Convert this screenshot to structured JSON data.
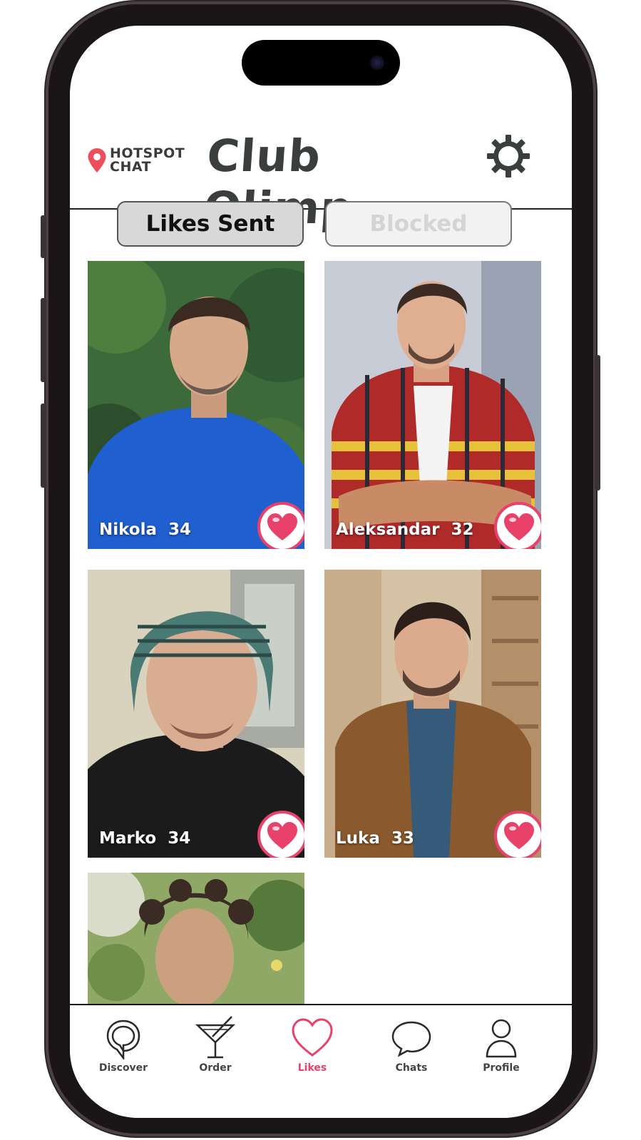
{
  "header": {
    "brand_line1": "HOTSPOT",
    "brand_line2": "CHAT",
    "title": "Club Olimp"
  },
  "tabs": [
    {
      "label": "Likes Sent",
      "active": true
    },
    {
      "label": "Blocked",
      "active": false
    }
  ],
  "profiles": [
    {
      "name": "Nikola",
      "age": "34",
      "display": "Nikola  34"
    },
    {
      "name": "Aleksandar",
      "age": "32",
      "display": "Aleksandar  32"
    },
    {
      "name": "Marko",
      "age": "34",
      "display": "Marko  34"
    },
    {
      "name": "Luka",
      "age": "33",
      "display": "Luka  33"
    },
    {
      "name": "",
      "age": "",
      "display": ""
    }
  ],
  "nav": [
    {
      "label": "Discover",
      "icon": "discover-icon",
      "active": false
    },
    {
      "label": "Order",
      "icon": "cocktail-icon",
      "active": false
    },
    {
      "label": "Likes",
      "icon": "heart-icon",
      "active": true
    },
    {
      "label": "Chats",
      "icon": "chat-bubble-icon",
      "active": false
    },
    {
      "label": "Profile",
      "icon": "user-icon",
      "active": false
    }
  ],
  "colors": {
    "accent": "#e8416a",
    "pin": "#ee4d5c",
    "title": "#3a3f3c"
  }
}
